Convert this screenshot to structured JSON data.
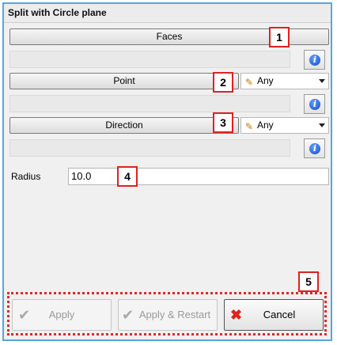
{
  "window": {
    "title": "Split with Circle plane"
  },
  "faces": {
    "button_label": "Faces",
    "callout": "1"
  },
  "point": {
    "button_label": "Point",
    "combo_value": "Any",
    "callout": "2"
  },
  "direction": {
    "button_label": "Direction",
    "combo_value": "Any",
    "callout": "3"
  },
  "radius": {
    "label": "Radius",
    "value": "10.0",
    "callout": "4"
  },
  "actions": {
    "callout": "5",
    "apply_label": "Apply",
    "apply_restart_label": "Apply & Restart",
    "cancel_label": "Cancel"
  },
  "icons": {
    "info": "info-icon",
    "wand": "magic-wand-icon",
    "check": "checkmark-icon",
    "cancel": "red-x-icon"
  },
  "colors": {
    "frame_border": "#55a6e0",
    "callout_border": "#e02020",
    "info_blue": "#1247c9"
  }
}
